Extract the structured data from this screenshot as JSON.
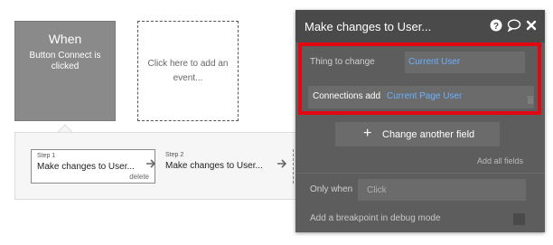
{
  "trigger": {
    "title": "When",
    "description": "Button Connect is clicked"
  },
  "add_event": {
    "text": "Click here to add an event..."
  },
  "steps": [
    {
      "label": "Step 1",
      "name": "Make changes to User...",
      "delete_label": "delete"
    },
    {
      "label": "Step 2",
      "name": "Make changes to User..."
    }
  ],
  "panel": {
    "title": "Make changes to User...",
    "thing_to_change": {
      "label": "Thing to change",
      "value": "Current User"
    },
    "field": {
      "label": "Connections add",
      "value": "Current Page User"
    },
    "change_button": "Change another field",
    "add_all_fields": "Add all fields",
    "only_when": {
      "label": "Only when",
      "placeholder": "Click"
    },
    "breakpoint": {
      "label": "Add a breakpoint in debug mode",
      "checked": false
    }
  },
  "colors": {
    "highlight": "#e30613",
    "dynamic_value": "#6ab0ff",
    "panel_bg": "#5d5d5d",
    "panel_header": "#4a4a4a"
  },
  "icons": [
    "help-icon",
    "comment-icon",
    "close-icon",
    "trash-icon",
    "plus-icon",
    "arrow-right-icon"
  ]
}
